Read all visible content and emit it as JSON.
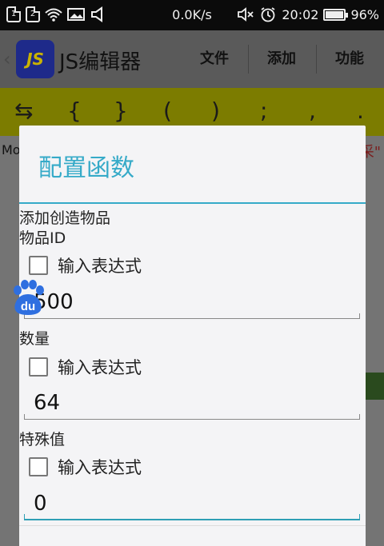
{
  "status_bar": {
    "sim1": "1",
    "sim2": "2",
    "speed": "0.0K/s",
    "time": "20:02",
    "battery": "96%",
    "battery_level": 0.96
  },
  "app": {
    "logo_text": "JS",
    "title": "JS编辑器",
    "menu": [
      "文件",
      "添加",
      "功能"
    ]
  },
  "toolbar": {
    "symbols": [
      "⇆",
      "{",
      "}",
      "(",
      ")",
      ";",
      ",",
      "."
    ]
  },
  "editor": {
    "left_text": "Mo",
    "right_text": "采\""
  },
  "dialog": {
    "title": "配置函数",
    "function_name": "添加创造物品",
    "fields": [
      {
        "label": "物品ID",
        "checkbox_label": "输入表达式",
        "value": "500"
      },
      {
        "label": "数量",
        "checkbox_label": "输入表达式",
        "value": "64"
      },
      {
        "label": "特殊值",
        "checkbox_label": "输入表达式",
        "value": "0"
      }
    ]
  },
  "floating_badge": {
    "text": "du"
  },
  "colors": {
    "accent": "#35aac8",
    "toolbar": "#7c7c00",
    "logo_bg": "#1e2a8a",
    "baidu_blue": "#2f6fe0"
  }
}
